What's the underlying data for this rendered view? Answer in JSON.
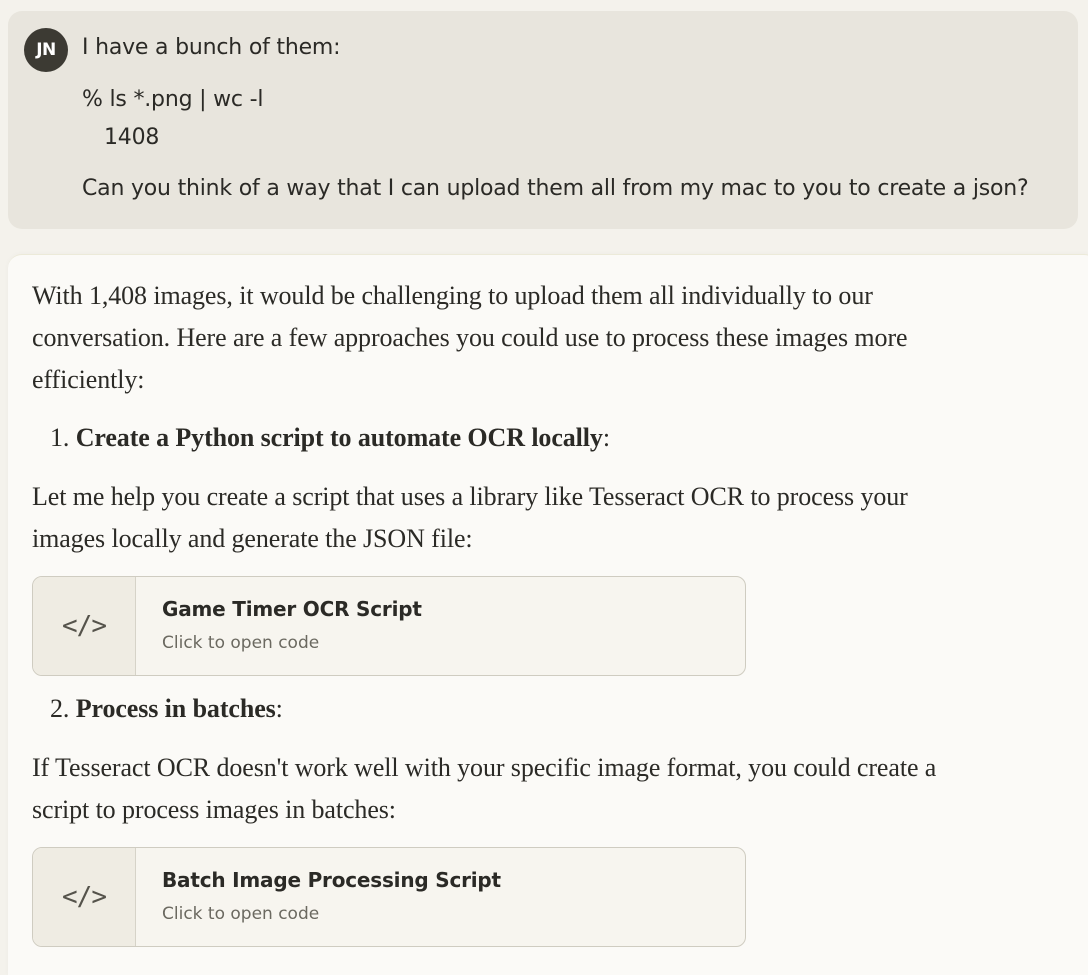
{
  "user_message": {
    "avatar_initials": "JN",
    "line1": "I have a bunch of them:",
    "code_line1": "% ls *.png | wc -l",
    "code_line2": "1408",
    "line2": "Can you think of a way that I can upload them all from my mac to you to create a json?"
  },
  "assistant_message": {
    "intro_line1": "With 1,408 images, it would be challenging to upload them all individually to our",
    "intro_line2": "conversation. Here are a few approaches you could use to process these images more",
    "intro_line3": "efficiently:",
    "step1": {
      "number": "1.",
      "title": "Create a Python script to automate OCR locally",
      "suffix": ":"
    },
    "step1_text_line1": "Let me help you create a script that uses a library like Tesseract OCR to process your",
    "step1_text_line2": "images locally and generate the JSON file:",
    "artifact1": {
      "icon": "code-icon",
      "icon_glyph": "</>",
      "title": "Game Timer OCR Script",
      "subtitle": "Click to open code"
    },
    "step2": {
      "number": "2.",
      "title": "Process in batches",
      "suffix": ":"
    },
    "step2_text_line1": "If Tesseract OCR doesn't work well with your specific image format, you could create a",
    "step2_text_line2": "script to process images in batches:",
    "artifact2": {
      "icon": "code-icon",
      "icon_glyph": "</>",
      "title": "Batch Image Processing Script",
      "subtitle": "Click to open code"
    }
  },
  "colors": {
    "page_background": "#f4f2ec",
    "user_bubble": "#e8e5dd",
    "avatar": "#3c3a33",
    "assistant_background": "#fbfaf7",
    "artifact_border": "#cfccc1"
  }
}
